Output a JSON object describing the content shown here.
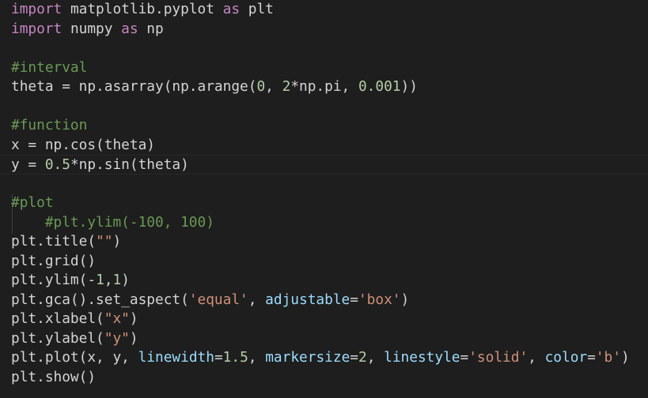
{
  "editor": {
    "lines": [
      [
        {
          "t": "import",
          "c": "kw"
        },
        {
          "t": " matplotlib.pyplot ",
          "c": "plain"
        },
        {
          "t": "as",
          "c": "kw"
        },
        {
          "t": " plt",
          "c": "plain"
        }
      ],
      [
        {
          "t": "import",
          "c": "kw"
        },
        {
          "t": " numpy ",
          "c": "plain"
        },
        {
          "t": "as",
          "c": "kw"
        },
        {
          "t": " np",
          "c": "plain"
        }
      ],
      [],
      [
        {
          "t": "#interval",
          "c": "cm"
        }
      ],
      [
        {
          "t": "theta = np.asarray(np.arange(",
          "c": "plain"
        },
        {
          "t": "0",
          "c": "num"
        },
        {
          "t": ", ",
          "c": "plain"
        },
        {
          "t": "2",
          "c": "num"
        },
        {
          "t": "*np.pi, ",
          "c": "plain"
        },
        {
          "t": "0.001",
          "c": "num"
        },
        {
          "t": "))",
          "c": "plain"
        }
      ],
      [],
      [
        {
          "t": "#function",
          "c": "cm"
        }
      ],
      [
        {
          "t": "x = np.cos(theta)",
          "c": "plain"
        }
      ],
      [
        {
          "t": "y = ",
          "c": "plain"
        },
        {
          "t": "0.5",
          "c": "num"
        },
        {
          "t": "*np.sin(theta)",
          "c": "plain"
        }
      ],
      [],
      [
        {
          "t": "#plot",
          "c": "cm"
        }
      ],
      [
        {
          "t": "    #plt.ylim(-100, 100)",
          "c": "cm"
        }
      ],
      [
        {
          "t": "plt.title(",
          "c": "plain"
        },
        {
          "t": "\"\"",
          "c": "str"
        },
        {
          "t": ")",
          "c": "plain"
        }
      ],
      [
        {
          "t": "plt.grid()",
          "c": "plain"
        }
      ],
      [
        {
          "t": "plt.ylim(-",
          "c": "plain"
        },
        {
          "t": "1",
          "c": "num"
        },
        {
          "t": ",",
          "c": "plain"
        },
        {
          "t": "1",
          "c": "num"
        },
        {
          "t": ")",
          "c": "plain"
        }
      ],
      [
        {
          "t": "plt.gca().set_aspect(",
          "c": "plain"
        },
        {
          "t": "'equal'",
          "c": "str"
        },
        {
          "t": ", ",
          "c": "plain"
        },
        {
          "t": "adjustable",
          "c": "param"
        },
        {
          "t": "=",
          "c": "plain"
        },
        {
          "t": "'box'",
          "c": "str"
        },
        {
          "t": ")",
          "c": "plain"
        }
      ],
      [
        {
          "t": "plt.xlabel(",
          "c": "plain"
        },
        {
          "t": "\"x\"",
          "c": "str"
        },
        {
          "t": ")",
          "c": "plain"
        }
      ],
      [
        {
          "t": "plt.ylabel(",
          "c": "plain"
        },
        {
          "t": "\"y\"",
          "c": "str"
        },
        {
          "t": ")",
          "c": "plain"
        }
      ],
      [
        {
          "t": "plt.plot(x, y, ",
          "c": "plain"
        },
        {
          "t": "linewidth",
          "c": "param"
        },
        {
          "t": "=",
          "c": "plain"
        },
        {
          "t": "1.5",
          "c": "num"
        },
        {
          "t": ", ",
          "c": "plain"
        },
        {
          "t": "markersize",
          "c": "param"
        },
        {
          "t": "=",
          "c": "plain"
        },
        {
          "t": "2",
          "c": "num"
        },
        {
          "t": ", ",
          "c": "plain"
        },
        {
          "t": "linestyle",
          "c": "param"
        },
        {
          "t": "=",
          "c": "plain"
        },
        {
          "t": "'solid'",
          "c": "str"
        },
        {
          "t": ", ",
          "c": "plain"
        },
        {
          "t": "color",
          "c": "param"
        },
        {
          "t": "=",
          "c": "plain"
        },
        {
          "t": "'b'",
          "c": "str"
        },
        {
          "t": ")",
          "c": "plain"
        }
      ],
      [
        {
          "t": "plt.show()",
          "c": "plain"
        }
      ]
    ],
    "current_line_index": 8
  },
  "colors": {
    "background": "#1e1e1e",
    "keyword": "#c586c0",
    "comment": "#6a9955",
    "number": "#b5cea8",
    "string": "#ce9178",
    "parameter": "#9cdcfe",
    "text": "#d4d4d4"
  }
}
